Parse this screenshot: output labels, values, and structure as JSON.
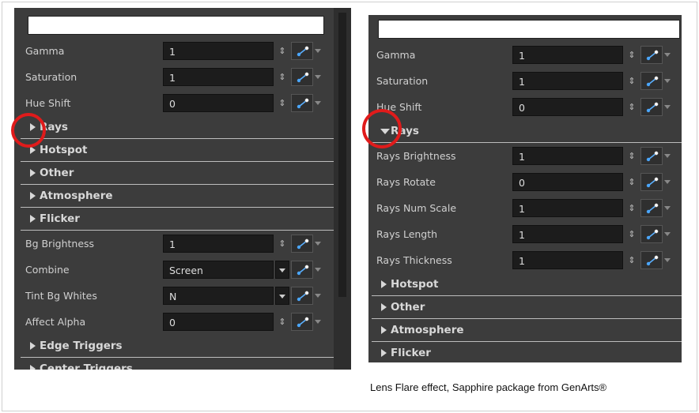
{
  "left_panel": {
    "rows_top": [
      {
        "label": "Gamma",
        "value": "1",
        "type": "spin"
      },
      {
        "label": "Saturation",
        "value": "1",
        "type": "spin"
      },
      {
        "label": "Hue Shift",
        "value": "0",
        "type": "spin"
      }
    ],
    "sections_top": [
      {
        "label": "Rays",
        "expanded": false
      },
      {
        "label": "Hotspot",
        "expanded": false
      },
      {
        "label": "Other",
        "expanded": false
      },
      {
        "label": "Atmosphere",
        "expanded": false
      },
      {
        "label": "Flicker",
        "expanded": false
      }
    ],
    "rows_bottom": [
      {
        "label": "Bg Brightness",
        "value": "1",
        "type": "spin"
      },
      {
        "label": "Combine",
        "value": "Screen",
        "type": "dropdown"
      },
      {
        "label": "Tint Bg Whites",
        "value": "N",
        "type": "dropdown"
      },
      {
        "label": "Affect Alpha",
        "value": "0",
        "type": "spin"
      }
    ],
    "sections_bottom": [
      {
        "label": "Edge Triggers",
        "expanded": false
      },
      {
        "label": "Center Triggers",
        "expanded": false
      }
    ]
  },
  "right_panel": {
    "rows_top": [
      {
        "label": "Gamma",
        "value": "1",
        "type": "spin"
      },
      {
        "label": "Saturation",
        "value": "1",
        "type": "spin"
      },
      {
        "label": "Hue Shift",
        "value": "0",
        "type": "spin"
      }
    ],
    "rays_section": {
      "label": "Rays",
      "expanded": true
    },
    "rays_rows": [
      {
        "label": "Rays Brightness",
        "value": "1",
        "type": "spin"
      },
      {
        "label": "Rays Rotate",
        "value": "0",
        "type": "spin"
      },
      {
        "label": "Rays Num Scale",
        "value": "1",
        "type": "spin"
      },
      {
        "label": "Rays Length",
        "value": "1",
        "type": "spin"
      },
      {
        "label": "Rays Thickness",
        "value": "1",
        "type": "spin"
      }
    ],
    "sections_bottom": [
      {
        "label": "Hotspot",
        "expanded": false
      },
      {
        "label": "Other",
        "expanded": false
      },
      {
        "label": "Atmosphere",
        "expanded": false
      },
      {
        "label": "Flicker",
        "expanded": false
      }
    ]
  },
  "caption": "Lens Flare effect,  Sapphire package from GenArts®",
  "colors": {
    "panel_bg": "#3c3c3c",
    "field_bg": "#1c1c1c",
    "highlight_circle": "#e01b1b"
  }
}
